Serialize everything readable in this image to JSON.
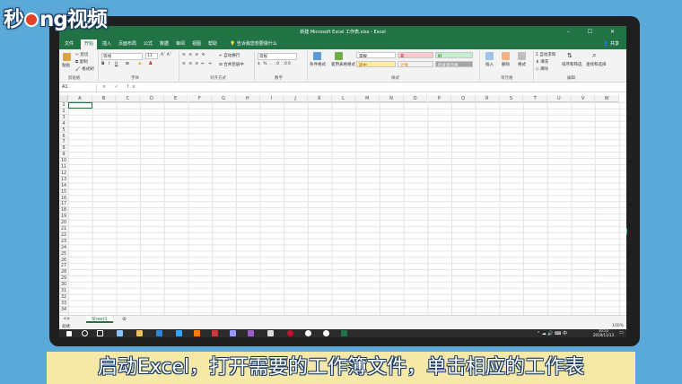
{
  "logo": {
    "part1": "秒",
    "part2": "ng视频",
    "letter": "d"
  },
  "window": {
    "title": "新建 Microsoft Excel 工作表.xlsx - Excel",
    "controls": "– ☐ ✕"
  },
  "tabs": [
    "开始",
    "插入",
    "页面布局",
    "公式",
    "数据",
    "审阅",
    "视图",
    "帮助"
  ],
  "tell_me": "告诉我您想要做什么",
  "share": "共享",
  "ribbon": {
    "clipboard": {
      "paste": "粘贴",
      "cut": "剪切",
      "copy": "复制",
      "format_painter": "格式刷",
      "label": "剪贴板"
    },
    "font": {
      "name": "等线",
      "size": "11",
      "bold": "B",
      "italic": "I",
      "underline": "U",
      "label": "字体"
    },
    "alignment": {
      "wrap": "自动换行",
      "merge": "合并后居中",
      "label": "对齐方式"
    },
    "number": {
      "format": "常规",
      "label": "数字"
    },
    "styles": {
      "conditional": "条件格式",
      "table": "套用表格格式",
      "normal": "常规",
      "bad": "差",
      "good": "好",
      "neutral": "适中",
      "calc": "计算",
      "check": "检查单元格",
      "label": "样式"
    },
    "cells": {
      "insert": "插入",
      "delete": "删除",
      "format": "格式",
      "label": "单元格"
    },
    "editing": {
      "autosum": "自动求和",
      "fill": "填充",
      "clear": "清除",
      "sort": "排序和筛选",
      "find": "查找和选择",
      "label": "编辑"
    }
  },
  "formula_bar": {
    "name_box": "A1",
    "symbols": "× ✓ fx"
  },
  "columns": [
    "A",
    "B",
    "C",
    "D",
    "E",
    "F",
    "G",
    "H",
    "I",
    "J",
    "K",
    "L",
    "M",
    "N",
    "O",
    "P",
    "Q",
    "R",
    "S",
    "T",
    "U",
    "V",
    "W"
  ],
  "rows": [
    "1",
    "2",
    "3",
    "4",
    "5",
    "6",
    "7",
    "8",
    "9",
    "10",
    "11",
    "12",
    "13",
    "14",
    "15",
    "16",
    "17",
    "18",
    "19",
    "20",
    "21",
    "22",
    "23",
    "24",
    "25",
    "26",
    "27",
    "28",
    "29",
    "30",
    "31",
    "32",
    "33",
    "34"
  ],
  "sheet": {
    "tab": "Sheet1",
    "add": "⊕"
  },
  "status": {
    "ready": "就绪",
    "zoom": "100%"
  },
  "taskbar": {
    "time": "16:55",
    "date": "2019/11/13"
  },
  "subtitle": "启动Excel，打开需要的工作簿文件，单击相应的工作表",
  "colors": {
    "excel_green": "#217346",
    "background": "#5aa9d8",
    "subtitle_bg": "#f6e9a7"
  }
}
